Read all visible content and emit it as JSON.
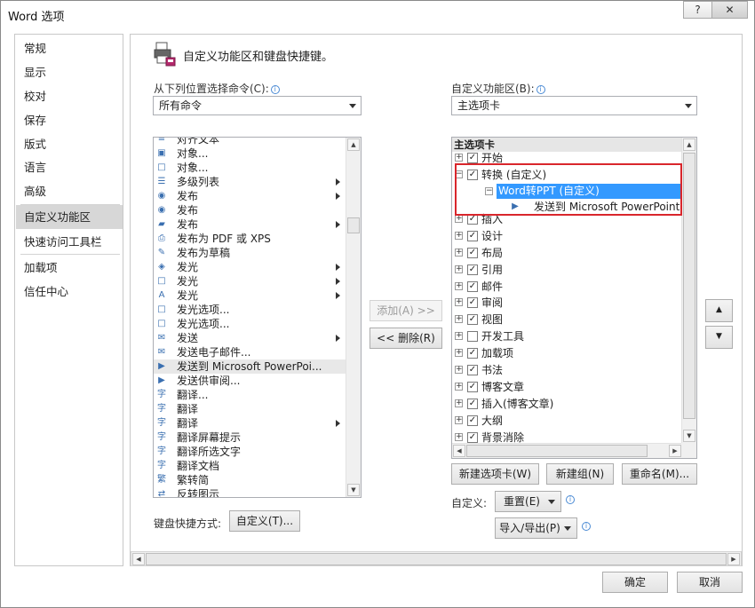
{
  "window": {
    "title": "Word 选项",
    "help_label": "?",
    "close_label": "✕"
  },
  "nav": {
    "items": [
      "常规",
      "显示",
      "校对",
      "保存",
      "版式",
      "语言",
      "高级",
      "自定义功能区",
      "快速访问工具栏",
      "加载项",
      "信任中心"
    ],
    "selected": "自定义功能区"
  },
  "header": {
    "heading": "自定义功能区和键盘快捷键。"
  },
  "commands": {
    "label": "从下列位置选择命令(C):",
    "dropdown_value": "所有命令",
    "items": [
      {
        "label": "对齐文本",
        "icon": "align-icon",
        "submenu": false
      },
      {
        "label": "对象...",
        "icon": "object-icon",
        "submenu": false
      },
      {
        "label": "对象...",
        "icon": "object-frame-icon",
        "submenu": false
      },
      {
        "label": "多级列表",
        "icon": "multilevel-list-icon",
        "submenu": true
      },
      {
        "label": "发布",
        "icon": "publish-icon",
        "submenu": true
      },
      {
        "label": "发布",
        "icon": "publish-icon",
        "submenu": false
      },
      {
        "label": "发布",
        "icon": "publish-folder-icon",
        "submenu": true
      },
      {
        "label": "发布为 PDF 或 XPS",
        "icon": "pdf-icon",
        "submenu": false
      },
      {
        "label": "发布为草稿",
        "icon": "draft-icon",
        "submenu": false
      },
      {
        "label": "发光",
        "icon": "glow-icon",
        "submenu": true
      },
      {
        "label": "发光",
        "icon": "glow-shape-icon",
        "submenu": true
      },
      {
        "label": "发光",
        "icon": "glow-text-icon",
        "submenu": true
      },
      {
        "label": "发光选项...",
        "icon": "glow-options-icon",
        "submenu": false
      },
      {
        "label": "发光选项...",
        "icon": "glow-options-icon",
        "submenu": false
      },
      {
        "label": "发送",
        "icon": "send-icon",
        "submenu": true
      },
      {
        "label": "发送电子邮件...",
        "icon": "email-icon",
        "submenu": false
      },
      {
        "label": "发送到 Microsoft PowerPoi...",
        "icon": "powerpoint-icon",
        "submenu": false
      },
      {
        "label": "发送供审阅...",
        "icon": "review-icon",
        "submenu": false
      },
      {
        "label": "翻译...",
        "icon": "translate-icon",
        "submenu": false
      },
      {
        "label": "翻译",
        "icon": "translate-icon",
        "submenu": false
      },
      {
        "label": "翻译",
        "icon": "translate-icon",
        "submenu": true
      },
      {
        "label": "翻译屏幕提示",
        "icon": "translate-tip-icon",
        "submenu": false
      },
      {
        "label": "翻译所选文字",
        "icon": "translate-selection-icon",
        "submenu": false
      },
      {
        "label": "翻译文档",
        "icon": "translate-doc-icon",
        "submenu": false
      },
      {
        "label": "繁转简",
        "icon": "trad-to-simp-icon",
        "submenu": false
      },
      {
        "label": "反转图示",
        "icon": "reverse-diagram-icon",
        "submenu": false
      }
    ],
    "selected": "发送到 Microsoft PowerPoi..."
  },
  "middle": {
    "add_label": "添加(A) >>",
    "remove_label": "<< 删除(R)"
  },
  "ribbon": {
    "label": "自定义功能区(B):",
    "dropdown_value": "主选项卡",
    "tree_header": "主选项卡",
    "tabs": [
      {
        "label": "开始",
        "checked": true
      },
      {
        "label": "转换 (自定义)",
        "checked": true
      },
      {
        "label": "插入",
        "checked": true
      },
      {
        "label": "设计",
        "checked": true
      },
      {
        "label": "布局",
        "checked": true
      },
      {
        "label": "引用",
        "checked": true
      },
      {
        "label": "邮件",
        "checked": true
      },
      {
        "label": "审阅",
        "checked": true
      },
      {
        "label": "视图",
        "checked": true
      },
      {
        "label": "开发工具",
        "checked": false
      },
      {
        "label": "加载项",
        "checked": true
      },
      {
        "label": "书法",
        "checked": true
      },
      {
        "label": "博客文章",
        "checked": true
      },
      {
        "label": "插入(博客文章)",
        "checked": true
      },
      {
        "label": "大纲",
        "checked": true
      },
      {
        "label": "背景消除",
        "checked": true
      }
    ],
    "group_label": "Word转PPT (自定义)",
    "command_label": "发送到 Microsoft PowerPoint",
    "new_tab_label": "新建选项卡(W)",
    "new_group_label": "新建组(N)",
    "rename_label": "重命名(M)...",
    "customize_label": "自定义:",
    "reset_label": "重置(E)",
    "import_export_label": "导入/导出(P)",
    "move_up_label": "▲",
    "move_down_label": "▼"
  },
  "keyboard": {
    "label": "键盘快捷方式:",
    "button_label": "自定义(T)..."
  },
  "footer": {
    "ok_label": "确定",
    "cancel_label": "取消"
  },
  "colors": {
    "selection": "#3399ff",
    "highlight_box": "#d9262c",
    "nav_selected": "#d7d7d7"
  }
}
